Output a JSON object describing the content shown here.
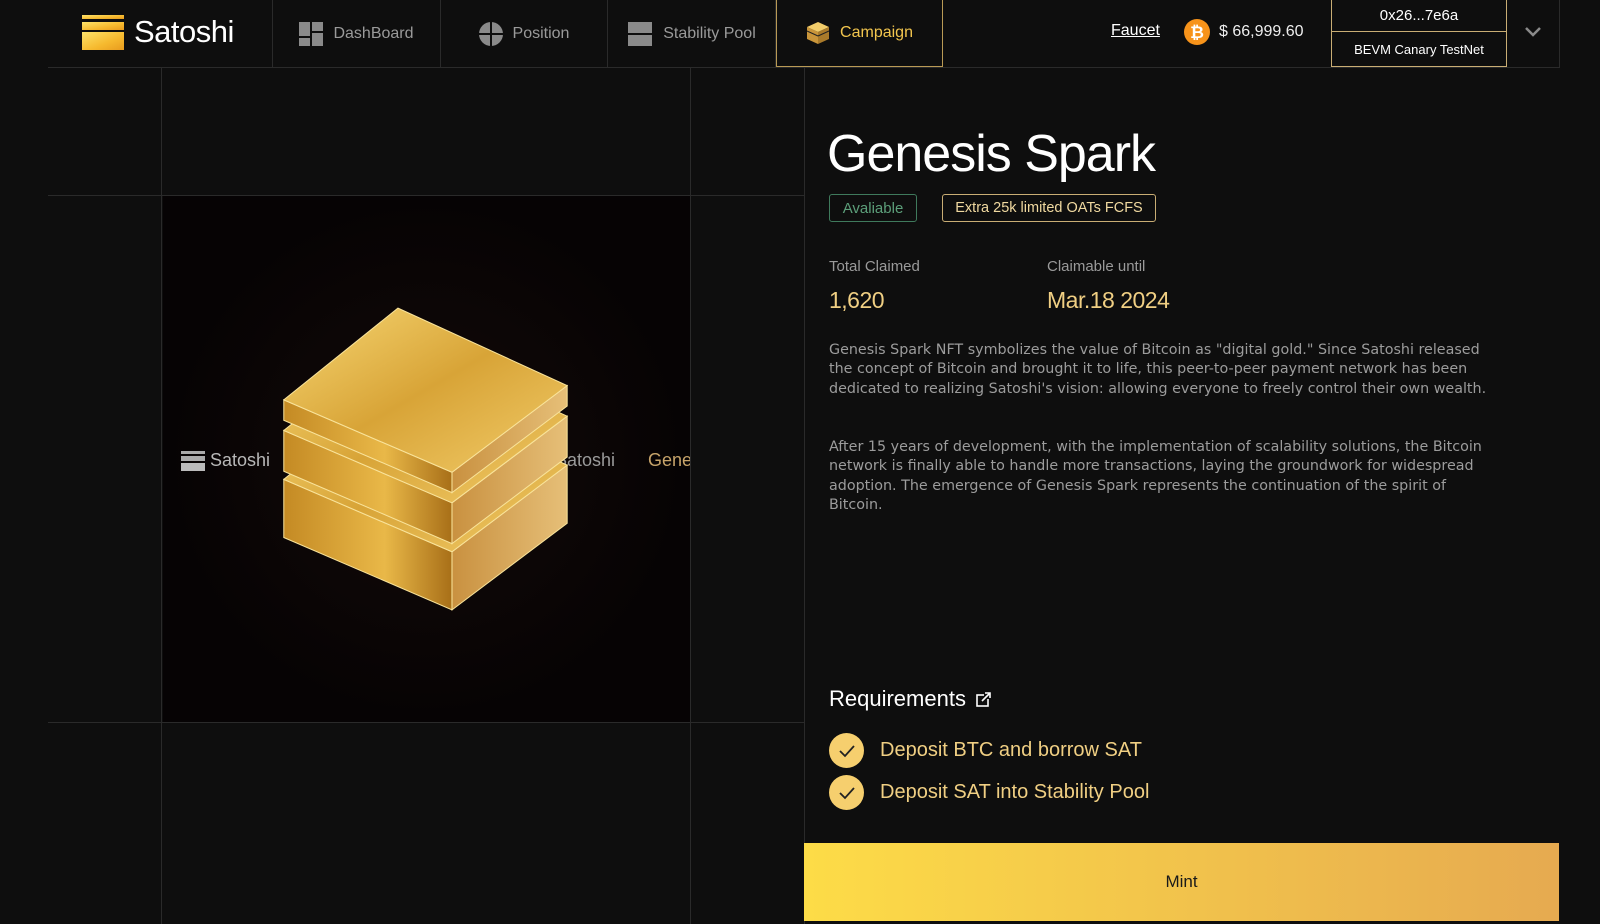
{
  "header": {
    "logo_text": "Satoshi",
    "nav": [
      {
        "label": "DashBoard",
        "icon": "dashboard-icon"
      },
      {
        "label": "Position",
        "icon": "position-icon"
      },
      {
        "label": "Stability Pool",
        "icon": "stability-pool-icon"
      },
      {
        "label": "Campaign",
        "icon": "campaign-icon",
        "active": true
      }
    ],
    "faucet_label": "Faucet",
    "btc_price": "$ 66,999.60",
    "wallet_address": "0x26...7e6a",
    "network": "BEVM Canary TestNet"
  },
  "nft": {
    "image_marquee": [
      "Satoshi",
      "Satoshi",
      "Gene"
    ]
  },
  "detail": {
    "title": "Genesis Spark",
    "status_badge": "Avaliable",
    "extra_badge": "Extra 25k limited OATs FCFS",
    "total_claimed_label": "Total Claimed",
    "total_claimed_value": "1,620",
    "claimable_until_label": "Claimable until",
    "claimable_until_value": "Mar.18 2024",
    "paragraphs": [
      "Genesis Spark NFT symbolizes the value of Bitcoin as \"digital gold.\" Since Satoshi released the concept of Bitcoin and brought it to life, this peer-to-peer payment network has been dedicated to realizing Satoshi's vision: allowing everyone to freely control their own wealth.",
      "After 15 years of development, with the implementation of scalability solutions, the Bitcoin network is finally able to handle more transactions, laying the groundwork for widespread adoption. The emergence of Genesis Spark represents the continuation of the spirit of Bitcoin."
    ],
    "requirements_title": "Requirements",
    "requirements": [
      {
        "label": "Deposit BTC and borrow SAT",
        "done": true
      },
      {
        "label": "Deposit SAT into Stability Pool",
        "done": true
      }
    ],
    "mint_label": "Mint"
  },
  "colors": {
    "accent_gold": "#f0cf83",
    "available_green": "#3f7a5c",
    "mint_gradient_start": "#fddc47",
    "mint_gradient_end": "#e6aa50",
    "btc_orange": "#f7931a"
  }
}
